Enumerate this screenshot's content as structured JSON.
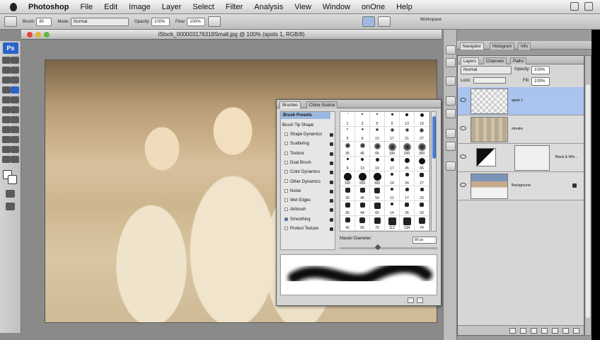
{
  "menubar": {
    "app": "Photoshop",
    "items": [
      "File",
      "Edit",
      "Image",
      "Layer",
      "Select",
      "Filter",
      "Analysis",
      "View",
      "Window",
      "onOne",
      "Help"
    ]
  },
  "options": {
    "brush_label": "Brush:",
    "brush_size": "80",
    "mode_label": "Mode:",
    "mode_value": "Normal",
    "opacity_label": "Opacity:",
    "opacity_value": "100%",
    "flow_label": "Flow:",
    "flow_value": "100%",
    "workspace": "Workspace"
  },
  "toolbar": {
    "logo": "Ps"
  },
  "document": {
    "title": "iStock_000003176319Small.jpg @ 100% (spots 1, RGB/8)"
  },
  "brushes": {
    "tabs": [
      "Brushes",
      "Clone Source"
    ],
    "presets_label": "Brush Presets",
    "tip_label": "Brush Tip Shape",
    "options": [
      {
        "label": "Shape Dynamics",
        "checked": false
      },
      {
        "label": "Scattering",
        "checked": false
      },
      {
        "label": "Texture",
        "checked": false
      },
      {
        "label": "Dual Brush",
        "checked": false
      },
      {
        "label": "Color Dynamics",
        "checked": false
      },
      {
        "label": "Other Dynamics",
        "checked": false
      },
      {
        "label": "Noise",
        "checked": false
      },
      {
        "label": "Wet Edges",
        "checked": false
      },
      {
        "label": "Airbrush",
        "checked": false
      },
      {
        "label": "Smoothing",
        "checked": true
      },
      {
        "label": "Protect Texture",
        "checked": false
      }
    ],
    "grid": [
      "1",
      "3",
      "5",
      "9",
      "13",
      "19",
      "5",
      "9",
      "13",
      "17",
      "21",
      "27",
      "35",
      "45",
      "65",
      "100",
      "200",
      "300",
      "9",
      "13",
      "19",
      "17",
      "45",
      "65",
      "100",
      "200",
      "300",
      "14",
      "24",
      "27",
      "39",
      "46",
      "59",
      "11",
      "17",
      "23",
      "36",
      "44",
      "60",
      "14",
      "26",
      "33",
      "42",
      "55",
      "70",
      "112",
      "134",
      "74"
    ],
    "master_diameter_label": "Master Diameter",
    "master_diameter_value": "80 px"
  },
  "navigator": {
    "tabs": [
      "Navigator",
      "Histogram",
      "Info"
    ]
  },
  "layers": {
    "tabs": [
      "Layers",
      "Channels",
      "Paths"
    ],
    "blend_mode": "Normal",
    "opacity_label": "Opacity:",
    "opacity_value": "100%",
    "lock_label": "Lock:",
    "fill_label": "Fill:",
    "fill_value": "100%",
    "rows": [
      {
        "name": "spots 1",
        "selected": true
      },
      {
        "name": "streaks",
        "selected": false
      },
      {
        "name": "Black & Whi...",
        "selected": false
      },
      {
        "name": "Background",
        "selected": false
      }
    ]
  }
}
